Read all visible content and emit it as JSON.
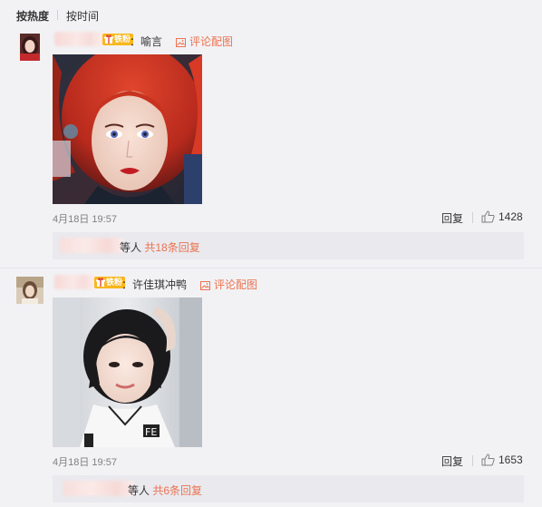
{
  "sort": {
    "hot_label": "按热度",
    "time_label": "按时间"
  },
  "comments": [
    {
      "badge": "铁粉",
      "text": "：喻言",
      "caption_link": "评论配图",
      "timestamp": "4月18日 19:57",
      "reply_label": "回复",
      "like_count": "1428",
      "reply_summary_etc": "等人",
      "reply_summary_count": "共18条回复"
    },
    {
      "badge": "铁粉",
      "text": "：许佳琪冲鸭",
      "caption_link": "评论配图",
      "timestamp": "4月18日 19:57",
      "reply_label": "回复",
      "like_count": "1653",
      "reply_summary_etc": "等人",
      "reply_summary_count": "共6条回复"
    }
  ],
  "colors": {
    "accent": "#eb7350",
    "badge": "#f8b71d",
    "background": "#f2f2f5",
    "reply_box": "#e9e9ee"
  },
  "icons": {
    "picture": "picture-icon",
    "like": "thumbs-up-icon",
    "badge": "gift-icon"
  }
}
